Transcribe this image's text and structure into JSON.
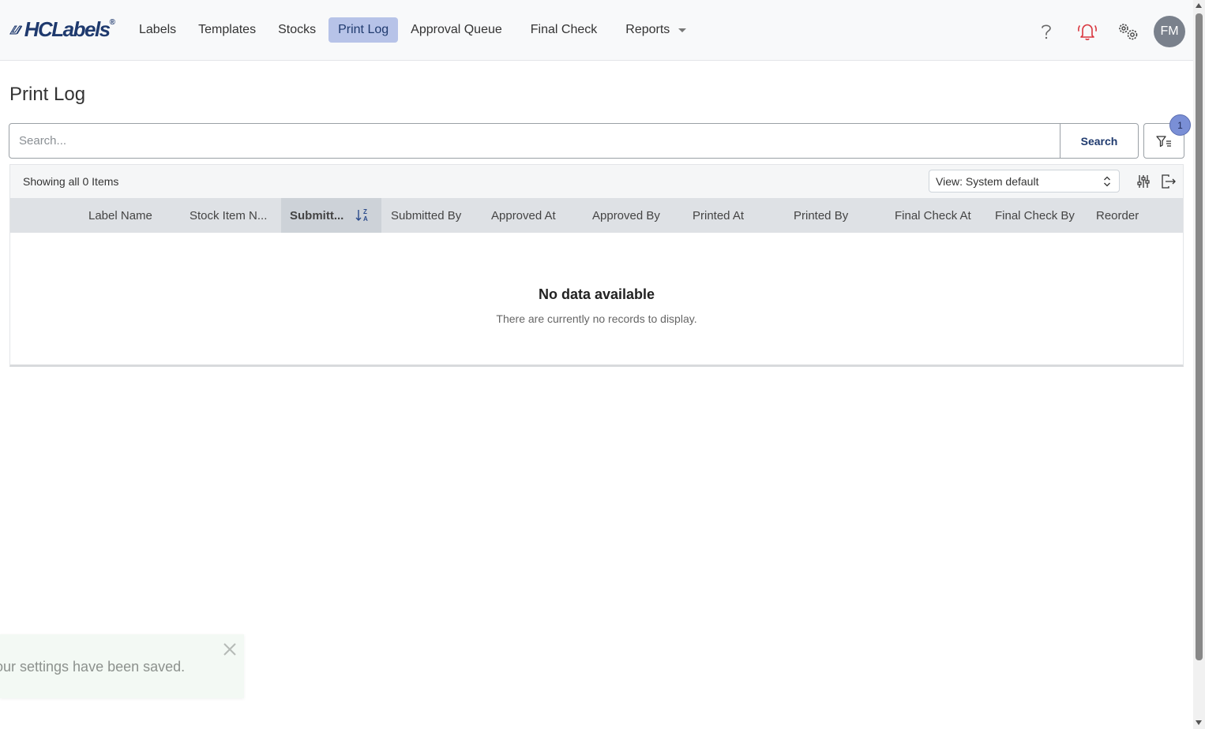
{
  "app": {
    "logo_text": "HCLabels",
    "logo_reg": "®"
  },
  "nav": {
    "items": [
      {
        "label": "Labels"
      },
      {
        "label": "Templates"
      },
      {
        "label": "Stocks"
      },
      {
        "label": "Print Log",
        "active": true
      },
      {
        "label": "Approval Queue"
      },
      {
        "label": "Final Check"
      },
      {
        "label": "Reports",
        "dropdown": true
      }
    ],
    "icons": [
      "help-icon",
      "bell-icon",
      "settings-icon"
    ],
    "avatar_initials": "FM",
    "bell_color": "#d9363e"
  },
  "page": {
    "title": "Print Log"
  },
  "search": {
    "placeholder": "Search...",
    "button_label": "Search",
    "filter_count": "1"
  },
  "grid": {
    "items_count": "Showing all 0 Items",
    "view_label": "View: System default",
    "columns": [
      {
        "label": "Label Name"
      },
      {
        "label": "Stock Item N..."
      },
      {
        "label": "Submitt...",
        "sorted": "desc"
      },
      {
        "label": "Submitted By"
      },
      {
        "label": "Approved At"
      },
      {
        "label": "Approved By"
      },
      {
        "label": "Printed At"
      },
      {
        "label": "Printed By"
      },
      {
        "label": "Final Check At"
      },
      {
        "label": "Final Check By"
      },
      {
        "label": "Reorder"
      }
    ],
    "empty_title": "No data available",
    "empty_subtitle": "There are currently no records to display."
  },
  "toast": {
    "message": "our settings have been saved."
  },
  "colors": {
    "brand": "#1f3a6e",
    "active_nav": "#b7c3e8",
    "header_bg": "#dee1e5",
    "toast_bg": "#f3f9f4"
  }
}
